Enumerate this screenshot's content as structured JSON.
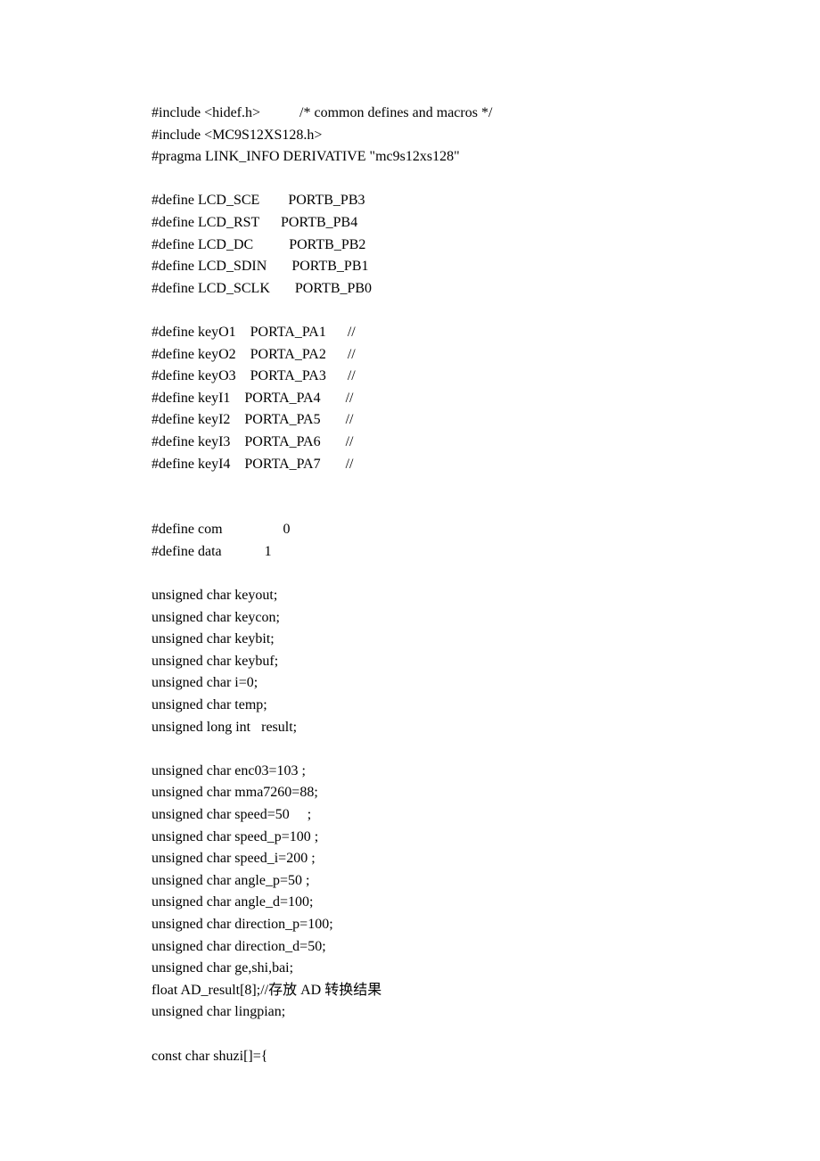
{
  "code": {
    "lines": [
      "#include <hidef.h>           /* common defines and macros */",
      "#include <MC9S12XS128.h>",
      "#pragma LINK_INFO DERIVATIVE \"mc9s12xs128\"",
      "",
      "#define LCD_SCE        PORTB_PB3",
      "#define LCD_RST      PORTB_PB4",
      "#define LCD_DC          PORTB_PB2",
      "#define LCD_SDIN       PORTB_PB1",
      "#define LCD_SCLK       PORTB_PB0",
      "",
      "#define keyO1    PORTA_PA1      //",
      "#define keyO2    PORTA_PA2      //",
      "#define keyO3    PORTA_PA3      //",
      "#define keyI1    PORTA_PA4       //",
      "#define keyI2    PORTA_PA5       //",
      "#define keyI3    PORTA_PA6       //",
      "#define keyI4    PORTA_PA7       //",
      "",
      "",
      "#define com                 0",
      "#define data            1",
      "",
      "unsigned char keyout;",
      "unsigned char keycon;",
      "unsigned char keybit;",
      "unsigned char keybuf;",
      "unsigned char i=0;",
      "unsigned char temp;",
      "unsigned long int   result;",
      "",
      "unsigned char enc03=103 ;",
      "unsigned char mma7260=88;",
      "unsigned char speed=50     ;",
      "unsigned char speed_p=100 ;",
      "unsigned char speed_i=200 ;",
      "unsigned char angle_p=50 ;",
      "unsigned char angle_d=100;",
      "unsigned char direction_p=100;",
      "unsigned char direction_d=50;",
      "unsigned char ge,shi,bai;",
      "float AD_result[8];//存放 AD 转换结果",
      "unsigned char lingpian;",
      "",
      "const char shuzi[]={"
    ]
  }
}
